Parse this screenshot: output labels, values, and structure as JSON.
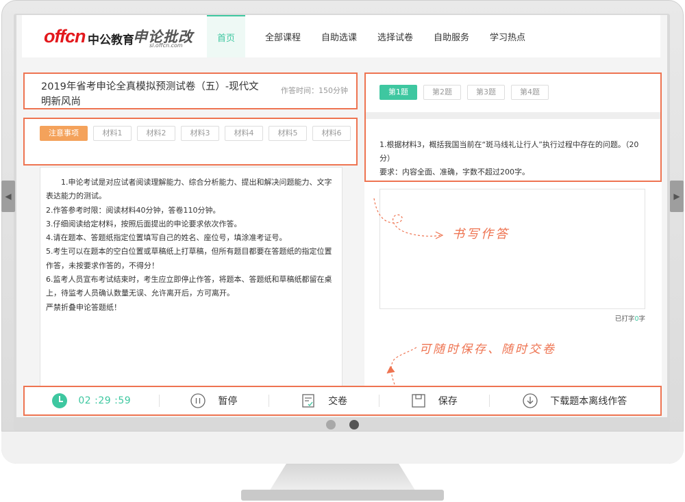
{
  "brand": {
    "logo_primary": "offcn",
    "logo_cn": "中公教育",
    "product": "申论批改",
    "product_url": "sl.offcn.com"
  },
  "nav": {
    "items": [
      {
        "label": "首页",
        "active": true
      },
      {
        "label": "全部课程",
        "active": false
      },
      {
        "label": "自助选课",
        "active": false
      },
      {
        "label": "选择试卷",
        "active": false
      },
      {
        "label": "自助服务",
        "active": false
      },
      {
        "label": "学习热点",
        "active": false
      }
    ]
  },
  "paper": {
    "title": "2019年省考申论全真模拟预测试卷（五）-现代文明新风尚",
    "exam_time": "作答时间：150分钟"
  },
  "material_tabs": [
    {
      "label": "注意事项",
      "active": true
    },
    {
      "label": "材料1",
      "active": false
    },
    {
      "label": "材料2",
      "active": false
    },
    {
      "label": "材料3",
      "active": false
    },
    {
      "label": "材料4",
      "active": false
    },
    {
      "label": "材料5",
      "active": false
    },
    {
      "label": "材料6",
      "active": false
    }
  ],
  "notes": [
    "1.申论考试是对应试者阅读理解能力、综合分析能力、提出和解决问题能力、文字表达能力的测试。",
    "2.作答参考时限：阅读材料40分钟，答卷110分钟。",
    "3.仔细阅读给定材料，按照后面提出的申论要求依次作答。",
    "4.请在题本、答题纸指定位置填写自己的姓名、座位号，填涂准考证号。",
    "5.考生可以在题本的空白位置或草稿纸上打草稿，但所有题目都要在答题纸的指定位置作答，未按要求作答的，不得分！",
    "6.监考人员宣布考试结束时，考生应立即停止作答，将题本、答题纸和草稿纸都留在桌上，待监考人员确认数量无误、允许离开后，方可离开。",
    "严禁折叠申论答题纸！"
  ],
  "question_tabs": [
    {
      "label": "第1题",
      "active": true
    },
    {
      "label": "第2题",
      "active": false
    },
    {
      "label": "第3题",
      "active": false
    },
    {
      "label": "第4题",
      "active": false
    }
  ],
  "question": {
    "text": "1.根据材料3，概括我国当前在“斑马线礼让行人”执行过程中存在的问题。（20分）",
    "requirement": "要求：内容全面、准确，字数不超过200字。"
  },
  "answer": {
    "value": "",
    "wordcount_prefix": "已打字",
    "wordcount_value": "0",
    "wordcount_suffix": "字"
  },
  "annotations": {
    "write_answer": "书写作答",
    "save_submit": "可随时保存、随时交卷"
  },
  "toolbar": {
    "timer": "02 :29 :59",
    "pause": "暂停",
    "submit": "交卷",
    "save": "保存",
    "download": "下载题本离线作答"
  },
  "colors": {
    "accent_green": "#3ec7a0",
    "highlight_orange": "#ee7350",
    "tab_orange": "#f4a25b"
  }
}
